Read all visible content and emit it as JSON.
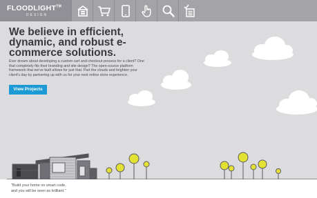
{
  "brand": {
    "name": "FLOODLIGHT",
    "tm": "TM",
    "tagline": "DESIGN"
  },
  "nav": {
    "items": [
      {
        "id": "store",
        "icon": "storefront-icon"
      },
      {
        "id": "cart",
        "icon": "shopping-cart-icon"
      },
      {
        "id": "mobile",
        "icon": "tablet-icon"
      },
      {
        "id": "touch",
        "icon": "pointer-hand-icon"
      },
      {
        "id": "search",
        "icon": "search-icon"
      },
      {
        "id": "checklist",
        "icon": "checklist-icon"
      }
    ]
  },
  "hero": {
    "title": "We believe in efficient, dynamic, and robust e-commerce solutions.",
    "body": "Ever dream about developing a custom cart and checkout process for a client? One that completely fits their branding and site design? The open-source platform framework that we've built allows for just that. Part the clouds and brighten your client's day by partnering up with us for your next online store experience.",
    "cta": "View Projects"
  },
  "footer": {
    "quote_line1": "\"Build your home on smart code,",
    "quote_line2": "and you will be seen as brilliant.\""
  },
  "colors": {
    "background": "#dcdcdf",
    "header": "#a4a4a8",
    "accent": "#1c9ad6",
    "tree_fill": "#e3e133",
    "ground": "#ffffff"
  }
}
